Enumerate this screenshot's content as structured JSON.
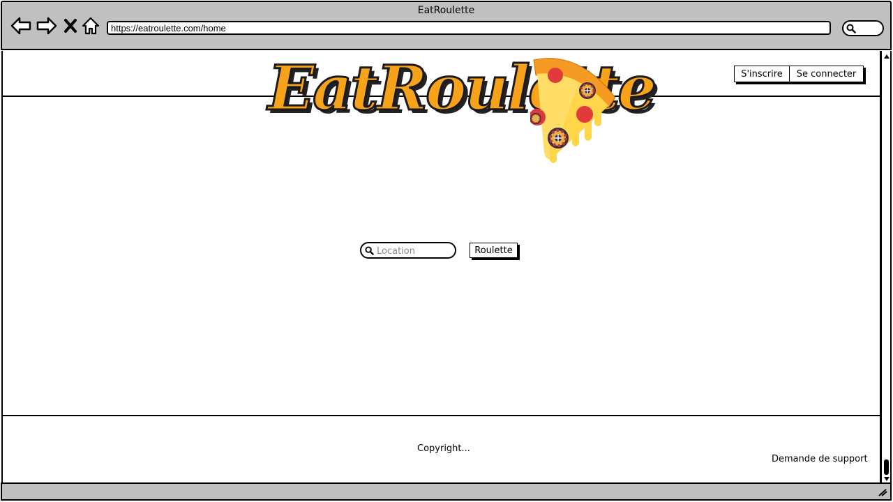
{
  "browser": {
    "window_title": "EatRoulette",
    "url": "https://eatroulette.com/home",
    "nav_icons": [
      "back-arrow-icon",
      "forward-arrow-icon",
      "close-icon",
      "home-icon"
    ]
  },
  "header": {
    "logo_text": "EatRoulette",
    "signup_label": "S'inscrire",
    "login_label": "Se connecter"
  },
  "search": {
    "placeholder": "Location",
    "button_label": "Roulette"
  },
  "footer": {
    "copyright": "Copyright...",
    "support_link": "Demande de support"
  },
  "colors": {
    "chrome": "#c0c0c0",
    "logo_orange": "#f7a21b",
    "pizza_crust": "#f59a23",
    "pepperoni": "#e03a3a",
    "cheese": "#ffd54a"
  }
}
